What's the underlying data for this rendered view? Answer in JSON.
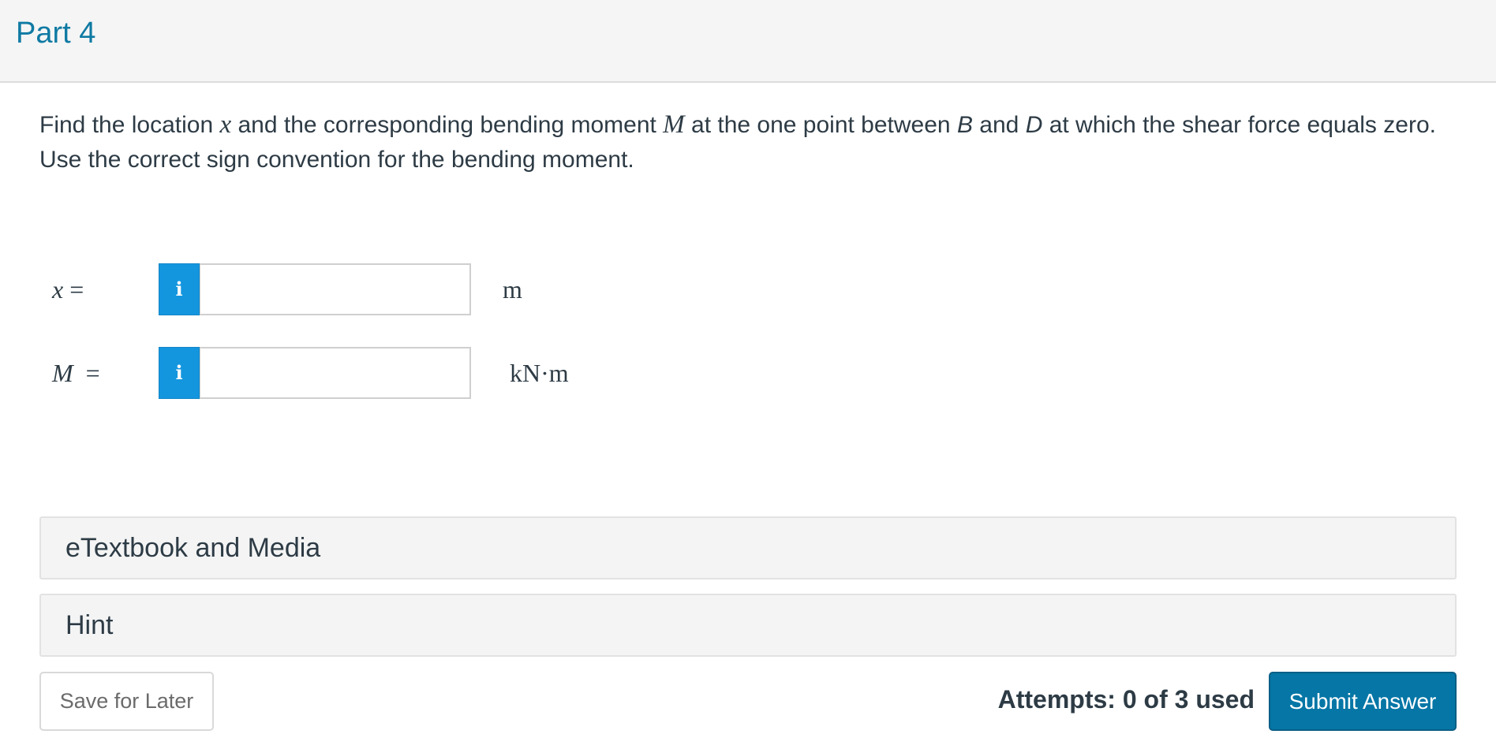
{
  "header": {
    "part_title": "Part 4"
  },
  "question": {
    "text_1": "Find the location ",
    "var_x": "x",
    "text_2": " and the corresponding bending moment ",
    "var_M": "M",
    "text_3": " at the one point between ",
    "var_B": "B",
    "text_4": " and ",
    "var_D": "D",
    "text_5": " at which the shear force equals zero.  Use the correct sign convention for the bending moment."
  },
  "answers": [
    {
      "label_var": "x",
      "label_eq": " =",
      "info_icon": "i",
      "value": "",
      "unit": "m"
    },
    {
      "label_var": "M",
      "label_eq": "  =",
      "info_icon": "i",
      "value": "",
      "unit": "kN·m"
    }
  ],
  "panels": {
    "etextbook_label": "eTextbook and Media",
    "hint_label": "Hint"
  },
  "footer": {
    "save_label": "Save for Later",
    "attempts_text": "Attempts: 0 of 3 used",
    "submit_label": "Submit Answer"
  },
  "colors": {
    "accent": "#0f7aa3",
    "info_button": "#1496df",
    "submit_button": "#0576a6"
  },
  "icons": {
    "info": "info-icon"
  }
}
